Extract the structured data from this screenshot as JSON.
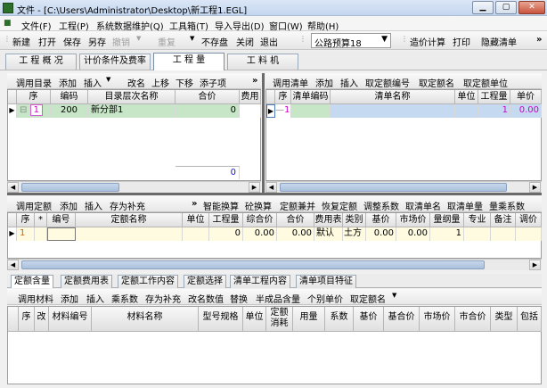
{
  "window": {
    "title": "文件 - [C:\\Users\\Administrator\\Desktop\\新工程1.EGL]",
    "min_label": "▁",
    "max_label": "▢",
    "close_label": "✕"
  },
  "menu": [
    "文件(F)",
    "工程(P)",
    "系统数据维护(Q)",
    "工具箱(T)",
    "导入导出(D)",
    "窗口(W)",
    "帮助(H)"
  ],
  "toolbar": {
    "buttons": [
      "新建",
      "打开",
      "保存",
      "另存",
      "撤销",
      "重复",
      "不存盘",
      "关闭",
      "退出"
    ],
    "disabled": [
      "撤销",
      "重复"
    ],
    "preset_combo": "公路预算18",
    "right_buttons": [
      "造价计算",
      "打印",
      "隐藏清单"
    ]
  },
  "main_tabs": [
    "工 程 概 况",
    "计价条件及费率",
    "工 程 量",
    "工 料 机"
  ],
  "directory_panel": {
    "toolbar": [
      "调用目录",
      "添加",
      "插入",
      "改名",
      "上移",
      "下移",
      "添子项"
    ],
    "columns": [
      "序",
      "编码",
      "目录层次名称",
      "合价",
      "费用"
    ],
    "rows": [
      {
        "seq": "1",
        "code": "200",
        "name": "新分部1",
        "total": "0"
      }
    ],
    "sum_value": "0"
  },
  "bill_panel": {
    "toolbar": [
      "调用清单",
      "添加",
      "插入",
      "取定额编号",
      "取定额名",
      "取定额单位"
    ],
    "columns": [
      "序",
      "清单编码",
      "清单名称",
      "单位",
      "工程量",
      "单价"
    ],
    "rows": [
      {
        "seq": "1",
        "code": "",
        "name": "",
        "unit": "",
        "qty": "1",
        "price": "0.00"
      }
    ]
  },
  "quota_panel": {
    "toolbar_left": [
      "调用定额",
      "添加",
      "插入",
      "存为补充"
    ],
    "toolbar_right": [
      "智能换算",
      "砼换算",
      "定额兼并",
      "恢复定额",
      "调整系数",
      "取清单名",
      "取清单量",
      "量乘系数"
    ],
    "columns": [
      "序",
      "*",
      "编号",
      "定额名称",
      "单位",
      "工程量",
      "综合价",
      "合价",
      "费用表",
      "类别",
      "基价",
      "市场价",
      "量纲量",
      "专业",
      "备注",
      "调价"
    ],
    "rows": [
      {
        "seq": "1",
        "qty": "0",
        "unit_price": "0.00",
        "total": "0.00",
        "fee_table": "默认",
        "category": "土方",
        "base": "0.00",
        "market": "0.00",
        "dim": "1"
      }
    ]
  },
  "bottom_tabs": [
    "定额含量",
    "定额费用表",
    "定额工作内容",
    "定额选择",
    "清单工程内容",
    "清单项目特征"
  ],
  "material_panel": {
    "toolbar": [
      "调用材料",
      "添加",
      "插入",
      "乘系数",
      "存为补充",
      "改名数值",
      "替换",
      "半成品含量",
      "个别单价",
      "取定额名"
    ],
    "columns": [
      "序",
      "改",
      "材料编号",
      "材料名称",
      "型号规格",
      "单位",
      "定额消耗",
      "用量",
      "系数",
      "基价",
      "基合价",
      "市场价",
      "市合价",
      "类型",
      "包括"
    ]
  },
  "colors": {
    "selection": "#c7e6c7",
    "total_value": "#1515cc",
    "pink_value": "#cc00cc"
  }
}
